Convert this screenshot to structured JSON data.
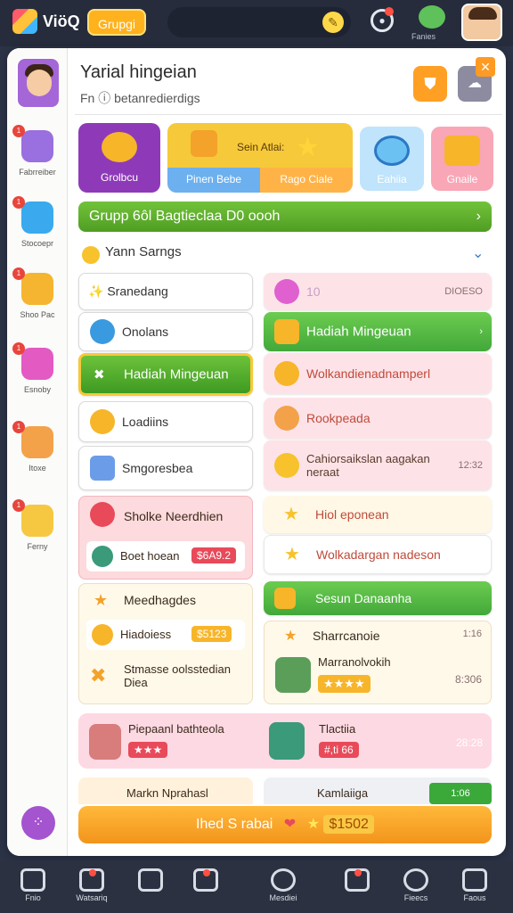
{
  "topbar": {
    "app_title": "ViöQ",
    "top_button": "Grupgi",
    "friends_label": "Fanies",
    "camera_icon": "camera-icon",
    "search_icon": "clock-icon"
  },
  "header": {
    "title": "Yarial hingeian",
    "subtitle": "Fn ⓘ betanredierdigs"
  },
  "sidebar": {
    "items": [
      {
        "label": "Fabrreiber",
        "badge": "1",
        "icon": "cloud-icon",
        "color": "#9a6fe0"
      },
      {
        "label": "Stocoepr",
        "badge": "1",
        "icon": "cube-icon",
        "color": "#3aa9ee"
      },
      {
        "label": "Shoo Pac",
        "badge": "1",
        "icon": "coin-icon",
        "color": "#f5b530"
      },
      {
        "label": "Esnoby",
        "badge": "1",
        "icon": "chat-icon",
        "color": "#e25ac2"
      },
      {
        "label": "Itoxe",
        "badge": "1",
        "icon": "character-icon",
        "color": "#f3a24a"
      },
      {
        "label": "Ferny",
        "badge": "1",
        "icon": "scroll-icon",
        "color": "#f6c842"
      }
    ]
  },
  "top_cards": [
    {
      "label": "Grolbcu",
      "icon": "gear-icon",
      "bg": "#8e3ab8"
    },
    {
      "label": "Sein Atlai:",
      "icon": "star-icon",
      "bg": "#f6c93a"
    },
    {
      "label": "Pinen Bebe",
      "icon": "gift-icon",
      "bg": "#6db0ef"
    },
    {
      "label": "Rago Ciale",
      "icon": "",
      "bg": "#ffb347"
    },
    {
      "label": "Eahiia",
      "icon": "search-icon",
      "bg": "#6cc1f3"
    },
    {
      "label": "Gnaile",
      "icon": "box-icon",
      "bg": "#f36f8e"
    }
  ],
  "green_banner": "Grupp 6ôl Bagtieclaa D0 oooh",
  "section_label": "Yann Sarngs",
  "left_list": [
    "✨ Sranedang",
    "Onolans",
    "Hadiah Mingeuan",
    "Loadiins",
    "Smgoresbea"
  ],
  "right_list": [
    {
      "text": "10",
      "badge": "DIOESO"
    },
    {
      "text": "Hadiah Mingeuan",
      "badge": "›"
    },
    {
      "text": "Wolkandienadnamperl",
      "badge": ""
    },
    {
      "text": "Rookpeada",
      "badge": ""
    },
    {
      "text": "Cahiorsaikslan aagakan neraat",
      "badge": "12:32"
    }
  ],
  "lower_left": {
    "header": "Sholke Neerdhien",
    "row_label": "Boet hoean",
    "row_price": "$6A9.2",
    "second_header": "Meedhagdes",
    "second_row": "Hiadoiess",
    "second_price": "$5123",
    "third_text": "Stmasse oolsstedian\nDiea"
  },
  "lower_right": {
    "row1": "Hiol eponean",
    "row2": "Wolkadargan nadeson",
    "green_row": "Sesun Danaanha",
    "detail_title": "Sharrcanoie",
    "detail_time": "1:16",
    "detail_name": "Marranolvokih",
    "detail_stars": "★★★★",
    "detail_value": "8:306"
  },
  "bottom_row": {
    "left_name": "Piepaanl bathteola",
    "left_stars": "★★★",
    "right_name": "Tlactiia",
    "right_price": "#​,ti 66",
    "right_time": "28:28"
  },
  "partial_row": {
    "left": "Markn Nprahasl",
    "right": "Kamlaiiga",
    "right_tag": "1:06"
  },
  "cta": {
    "label": "Ihed S rabai",
    "value": "$1502"
  },
  "navbar": {
    "items": [
      {
        "label": "Fnio",
        "icon": "home-icon"
      },
      {
        "label": "Watsariq",
        "icon": "group-icon"
      },
      {
        "label": "",
        "icon": "chat-icon"
      },
      {
        "label": "",
        "icon": "pen-icon"
      },
      {
        "label": "Mesdiei",
        "icon": "chat-bubble-icon"
      },
      {
        "label": "",
        "icon": "notice-icon"
      },
      {
        "label": "Fieecs",
        "icon": "globe-icon"
      },
      {
        "label": "Faous",
        "icon": "store-icon"
      }
    ]
  }
}
